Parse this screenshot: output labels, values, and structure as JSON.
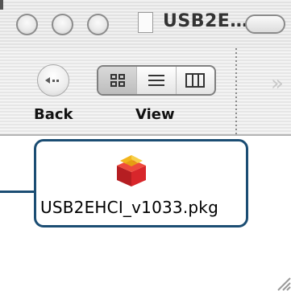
{
  "window": {
    "title": "USB2E…"
  },
  "toolbar": {
    "back_label": "Back",
    "view_label": "View",
    "overflow_glyph": "»"
  },
  "file": {
    "name": "USB2EHCI_v1033.pkg",
    "icon": "package-icon"
  },
  "colors": {
    "selection_border": "#1b4d73",
    "package_red": "#d8262b",
    "package_yellow": "#f2b51c"
  }
}
